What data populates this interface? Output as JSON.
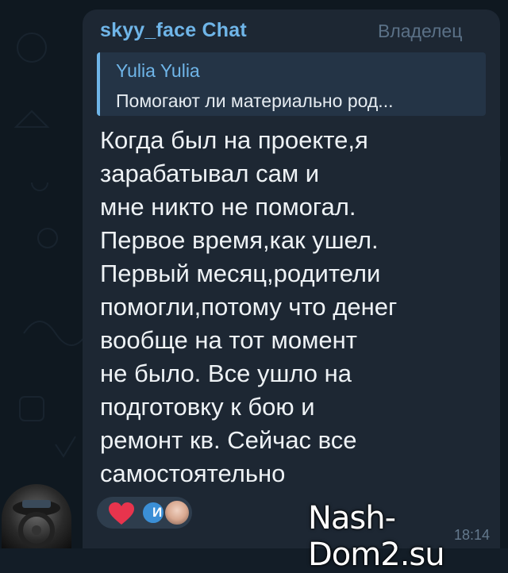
{
  "message": {
    "sender": "skyy_face Chat",
    "badge": "Владелец",
    "reply": {
      "name": "Yulia Yulia",
      "text": "Помогают ли материально род..."
    },
    "lines": [
      "Когда был на проекте,я",
      "зарабатывал сам и",
      "мне никто не помогал.",
      "Первое время,как ушел.",
      "Первый месяц,родители",
      "помогли,потому что денег",
      "вообще на тот момент",
      "не было. Все ушло на",
      "подготовку к бою и",
      "ремонт кв. Сейчас все",
      "самостоятельно"
    ],
    "reactions": {
      "emoji": "heart-icon",
      "avatar_initial": "И"
    },
    "time": "18:14"
  },
  "watermark": "Nash-Dom2.su",
  "colors": {
    "background": "#0f1820",
    "bubble": "#1d2733",
    "accent": "#6fb5e8",
    "reply_bg": "#243446",
    "text": "#eef2f5",
    "heart": "#e8344d"
  }
}
